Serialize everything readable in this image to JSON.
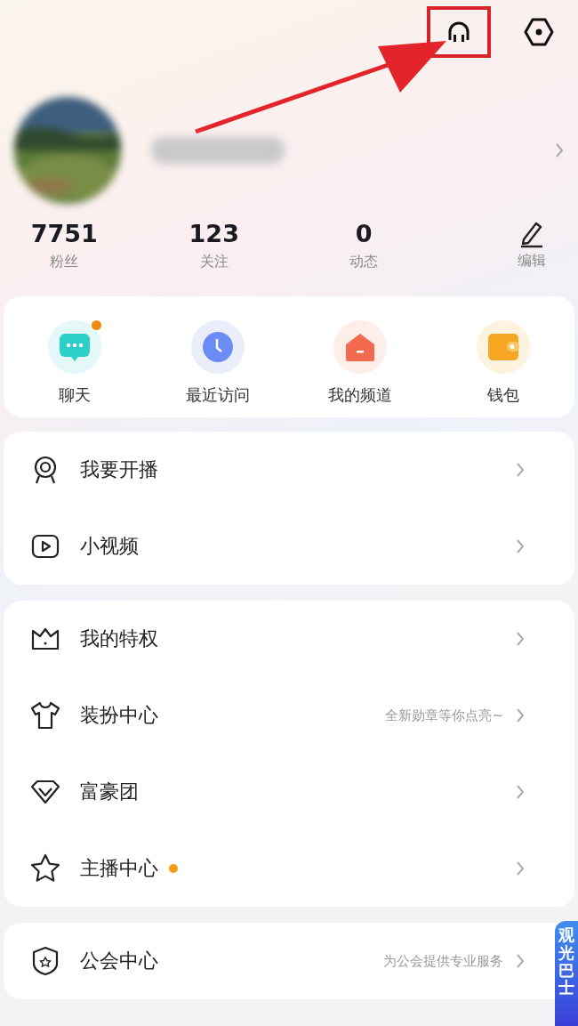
{
  "header": {
    "actions": [
      {
        "kind": "headset",
        "highlighted": true
      },
      {
        "kind": "settings",
        "highlighted": false
      }
    ]
  },
  "stats": [
    {
      "value": "7751",
      "label": "粉丝"
    },
    {
      "value": "123",
      "label": "关注"
    },
    {
      "value": "0",
      "label": "动态"
    }
  ],
  "edit": {
    "label": "编辑"
  },
  "quick_actions": [
    {
      "kind": "chat",
      "label": "聊天",
      "badge": true
    },
    {
      "kind": "clock",
      "label": "最近访问",
      "badge": false
    },
    {
      "kind": "house",
      "label": "我的频道",
      "badge": false
    },
    {
      "kind": "wallet",
      "label": "钱包",
      "badge": false
    }
  ],
  "menu_groups": [
    {
      "items": [
        {
          "kind": "live",
          "label": "我要开播",
          "dot": false
        },
        {
          "kind": "video",
          "label": "小视频",
          "dot": false
        }
      ]
    },
    {
      "items": [
        {
          "kind": "crown",
          "label": "我的特权",
          "dot": false
        },
        {
          "kind": "shirt",
          "label": "装扮中心",
          "hint": "全新勋章等你点亮~",
          "dot": false
        },
        {
          "kind": "diamond",
          "label": "富豪团",
          "dot": false
        },
        {
          "kind": "star",
          "label": "主播中心",
          "dot": true
        }
      ]
    },
    {
      "items": [
        {
          "kind": "shield",
          "label": "公会中心",
          "hint": "为公会提供专业服务",
          "dot": false
        }
      ]
    }
  ],
  "floating_banner": {
    "text": "观光巴士"
  }
}
